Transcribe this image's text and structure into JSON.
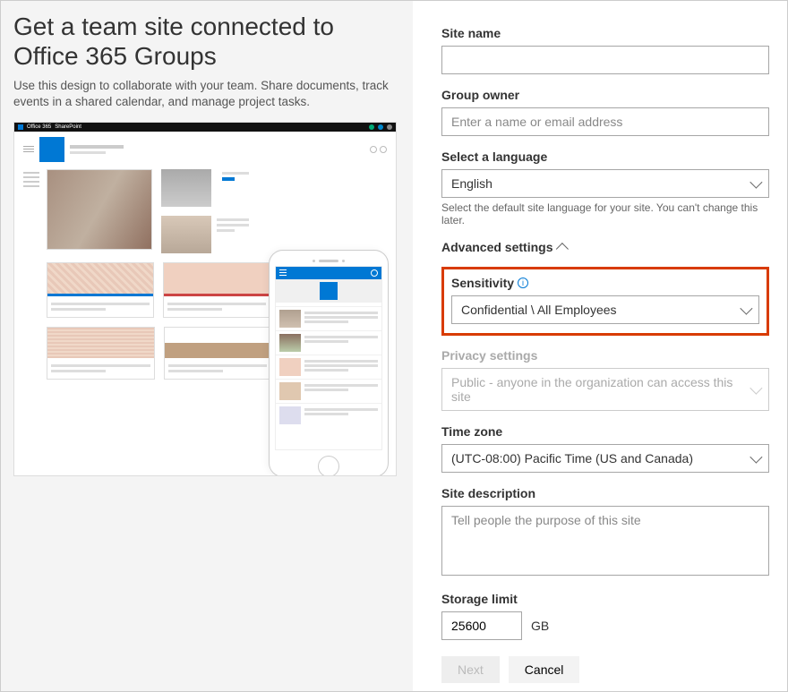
{
  "left": {
    "title": "Get a team site connected to Office 365 Groups",
    "description": "Use this design to collaborate with your team. Share documents, track events in a shared calendar, and manage project tasks.",
    "preview_app1": "Office 365",
    "preview_app2": "SharePoint"
  },
  "form": {
    "site_name_label": "Site name",
    "site_name_value": "",
    "group_owner_label": "Group owner",
    "group_owner_placeholder": "Enter a name or email address",
    "group_owner_value": "",
    "language_label": "Select a language",
    "language_value": "English",
    "language_helper": "Select the default site language for your site. You can't change this later.",
    "advanced_label": "Advanced settings",
    "sensitivity_label": "Sensitivity",
    "sensitivity_value": "Confidential \\ All Employees",
    "privacy_label": "Privacy settings",
    "privacy_value": "Public - anyone in the organization can access this site",
    "timezone_label": "Time zone",
    "timezone_value": "(UTC-08:00) Pacific Time (US and Canada)",
    "description_label": "Site description",
    "description_placeholder": "Tell people the purpose of this site",
    "description_value": "",
    "storage_label": "Storage limit",
    "storage_value": "25600",
    "storage_unit": "GB",
    "next_label": "Next",
    "cancel_label": "Cancel"
  }
}
